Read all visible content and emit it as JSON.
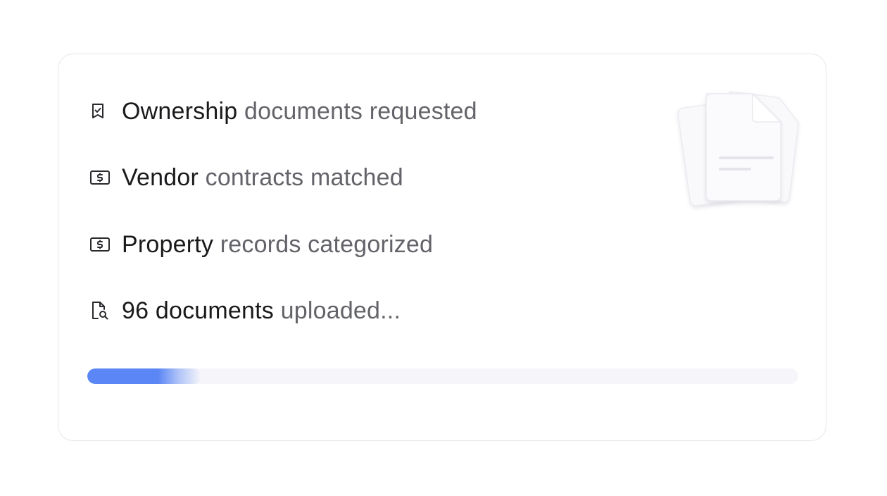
{
  "items": [
    {
      "icon": "receipt-check-icon",
      "strong": "Ownership",
      "muted": " documents requested"
    },
    {
      "icon": "money-bill-icon",
      "strong": "Vendor",
      "muted": " contracts matched"
    },
    {
      "icon": "money-bill-icon",
      "strong": "Property",
      "muted": " records categorized"
    },
    {
      "icon": "file-search-icon",
      "strong": "96 documents",
      "muted": " uploaded..."
    }
  ],
  "progress": {
    "percent": 16,
    "color": "#5b86f5"
  },
  "illustration": {
    "icon": "stacked-documents-icon"
  }
}
